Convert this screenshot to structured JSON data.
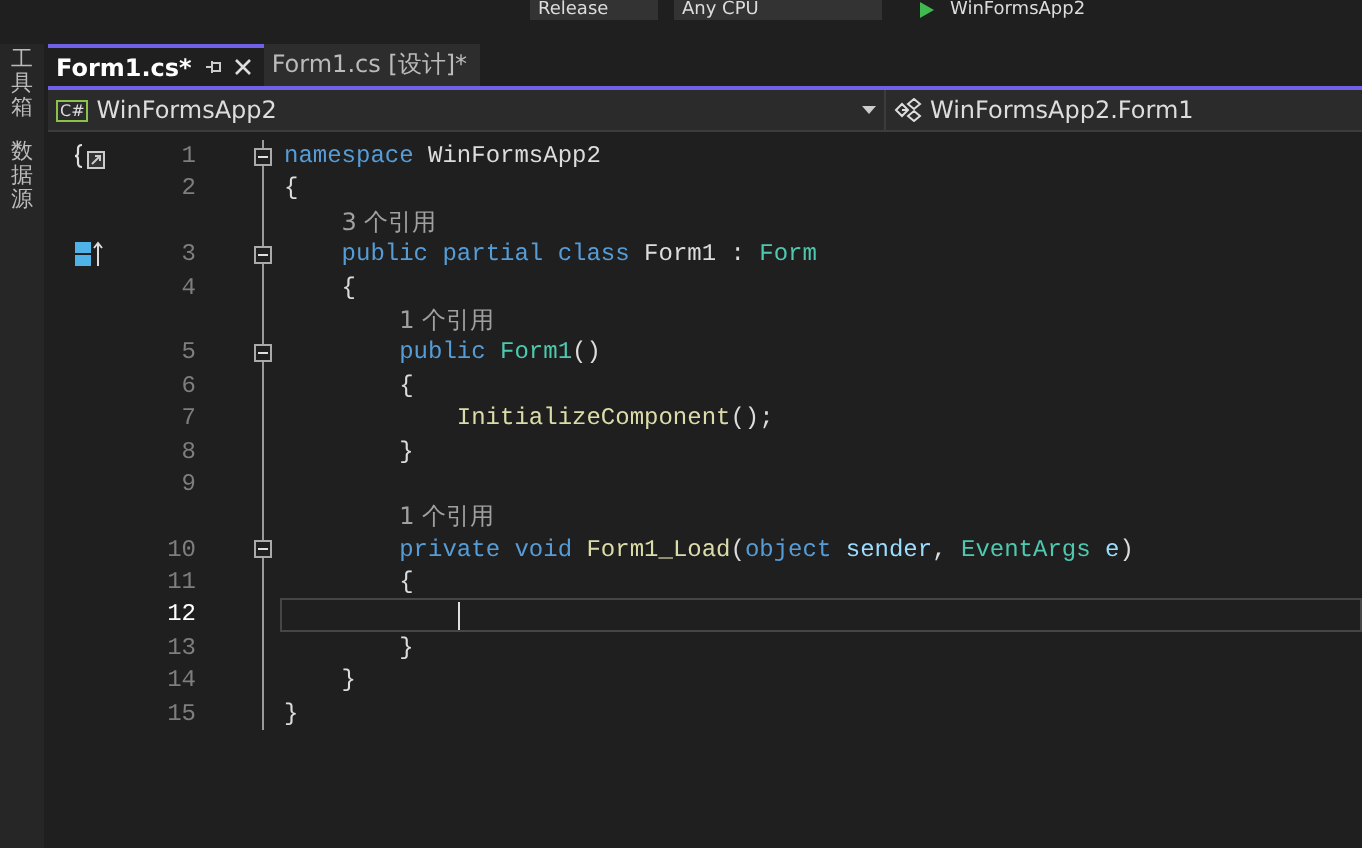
{
  "toolbar": {
    "configuration": "Release",
    "platform": "Any CPU",
    "start_target": "WinFormsApp2"
  },
  "side_strip": [
    {
      "label": "工具箱"
    },
    {
      "label": "数据源"
    }
  ],
  "tabs": [
    {
      "label": "Form1.cs*",
      "selected": true,
      "pinnable": true,
      "closable": true
    },
    {
      "label": "Form1.cs [设计]*",
      "selected": false,
      "pinnable": false,
      "closable": false
    }
  ],
  "nav_bar": {
    "language_badge": "C#",
    "project": "WinFormsApp2",
    "type": "WinFormsApp2.Form1"
  },
  "lines": [
    {
      "kind": "code",
      "number": "1",
      "collapsible": true,
      "current": false,
      "margin_icon": {
        "kind": "namespace"
      },
      "tokens": [
        {
          "t": "namespace ",
          "kind": "keyword"
        },
        {
          "t": "WinFormsApp2",
          "kind": "plain"
        }
      ]
    },
    {
      "kind": "code",
      "number": "2",
      "collapsible": false,
      "current": false,
      "tokens": [
        {
          "t": "{",
          "kind": "plain"
        }
      ]
    },
    {
      "kind": "block",
      "children": [
        {
          "kind": "codelens",
          "text": "3 个引用"
        },
        {
          "kind": "code",
          "number": "3",
          "collapsible": true,
          "current": false,
          "margin_icon": {
            "kind": "class"
          },
          "tokens": [
            {
              "t": "public ",
              "kind": "keyword"
            },
            {
              "t": "partial ",
              "kind": "keyword"
            },
            {
              "t": "class ",
              "kind": "keyword"
            },
            {
              "t": "Form1 : ",
              "kind": "plain"
            },
            {
              "t": "Form",
              "kind": "type"
            }
          ]
        },
        {
          "kind": "code",
          "number": "4",
          "collapsible": false,
          "current": false,
          "tokens": [
            {
              "t": "{",
              "kind": "plain"
            }
          ]
        },
        {
          "kind": "block",
          "children": [
            {
              "kind": "codelens",
              "text": "1 个引用"
            },
            {
              "kind": "code",
              "number": "5",
              "collapsible": true,
              "current": false,
              "tokens": [
                {
                  "t": "public ",
                  "kind": "keyword"
                },
                {
                  "t": "Form1",
                  "kind": "type"
                },
                {
                  "t": "()",
                  "kind": "plain"
                }
              ]
            },
            {
              "kind": "code",
              "number": "6",
              "collapsible": false,
              "current": false,
              "tokens": [
                {
                  "t": "{",
                  "kind": "plain"
                }
              ]
            },
            {
              "kind": "block",
              "children": [
                {
                  "kind": "code",
                  "number": "7",
                  "collapsible": false,
                  "current": false,
                  "tokens": [
                    {
                      "t": "InitializeComponent",
                      "kind": "method"
                    },
                    {
                      "t": "();",
                      "kind": "plain"
                    }
                  ]
                }
              ]
            },
            {
              "kind": "code",
              "number": "8",
              "collapsible": false,
              "current": false,
              "tokens": [
                {
                  "t": "}",
                  "kind": "plain"
                }
              ]
            },
            {
              "kind": "code",
              "number": "9",
              "collapsible": false,
              "current": false
            },
            {
              "kind": "codelens",
              "text": "1 个引用"
            },
            {
              "kind": "code",
              "number": "10",
              "collapsible": true,
              "current": false,
              "tokens": [
                {
                  "t": "private ",
                  "kind": "keyword"
                },
                {
                  "t": "void ",
                  "kind": "keyword"
                },
                {
                  "t": "Form1_Load",
                  "kind": "method"
                },
                {
                  "t": "(",
                  "kind": "plain"
                },
                {
                  "t": "object ",
                  "kind": "keyword"
                },
                {
                  "t": "sender",
                  "kind": "param"
                },
                {
                  "t": ", ",
                  "kind": "plain"
                },
                {
                  "t": "EventArgs ",
                  "kind": "type"
                },
                {
                  "t": "e",
                  "kind": "param"
                },
                {
                  "t": ")",
                  "kind": "plain"
                }
              ]
            },
            {
              "kind": "code",
              "number": "11",
              "collapsible": false,
              "current": false,
              "tokens": [
                {
                  "t": "{",
                  "kind": "plain"
                }
              ]
            },
            {
              "kind": "block",
              "children": [
                {
                  "kind": "code",
                  "number": "12",
                  "collapsible": false,
                  "current": true
                }
              ]
            },
            {
              "kind": "code",
              "number": "13",
              "collapsible": false,
              "current": false,
              "tokens": [
                {
                  "t": "}",
                  "kind": "plain"
                }
              ]
            }
          ]
        },
        {
          "kind": "code",
          "number": "14",
          "collapsible": false,
          "current": false,
          "tokens": [
            {
              "t": "}",
              "kind": "plain"
            }
          ]
        }
      ]
    },
    {
      "kind": "code",
      "number": "15",
      "collapsible": false,
      "current": false,
      "tokens": [
        {
          "t": "}",
          "kind": "plain"
        }
      ]
    }
  ]
}
